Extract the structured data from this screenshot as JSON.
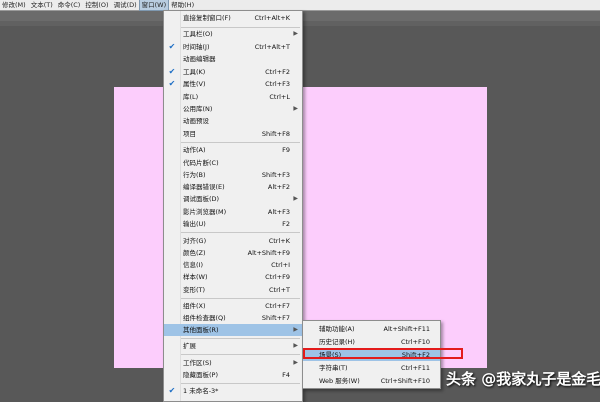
{
  "menubar": {
    "items": [
      {
        "label": "修改(M)"
      },
      {
        "label": "文本(T)"
      },
      {
        "label": "命令(C)"
      },
      {
        "label": "控制(O)"
      },
      {
        "label": "调试(D)"
      },
      {
        "label": "窗口(W)"
      },
      {
        "label": "帮助(H)"
      }
    ]
  },
  "window_menu": {
    "items": [
      {
        "label": "直接复制窗口(F)",
        "shortcut": "Ctrl+Alt+K",
        "checked": false,
        "submenu": false
      },
      {
        "label": "工具栏(O)",
        "shortcut": "",
        "checked": false,
        "submenu": true
      },
      {
        "label": "时间轴(J)",
        "shortcut": "Ctrl+Alt+T",
        "checked": true,
        "submenu": false
      },
      {
        "label": "动画编辑器",
        "shortcut": "",
        "checked": false,
        "submenu": false
      },
      {
        "label": "工具(K)",
        "shortcut": "Ctrl+F2",
        "checked": true,
        "submenu": false
      },
      {
        "label": "属性(V)",
        "shortcut": "Ctrl+F3",
        "checked": true,
        "submenu": false
      },
      {
        "label": "库(L)",
        "shortcut": "Ctrl+L",
        "checked": false,
        "submenu": false
      },
      {
        "label": "公用库(N)",
        "shortcut": "",
        "checked": false,
        "submenu": true
      },
      {
        "label": "动画预设",
        "shortcut": "",
        "checked": false,
        "submenu": false
      },
      {
        "label": "项目",
        "shortcut": "Shift+F8",
        "checked": false,
        "submenu": false
      },
      {
        "label": "动作(A)",
        "shortcut": "F9",
        "checked": false,
        "submenu": false
      },
      {
        "label": "代码片断(C)",
        "shortcut": "",
        "checked": false,
        "submenu": false
      },
      {
        "label": "行为(B)",
        "shortcut": "Shift+F3",
        "checked": false,
        "submenu": false
      },
      {
        "label": "编译器错误(E)",
        "shortcut": "Alt+F2",
        "checked": false,
        "submenu": false
      },
      {
        "label": "调试面板(D)",
        "shortcut": "",
        "checked": false,
        "submenu": true
      },
      {
        "label": "影片浏览器(M)",
        "shortcut": "Alt+F3",
        "checked": false,
        "submenu": false
      },
      {
        "label": "输出(U)",
        "shortcut": "F2",
        "checked": false,
        "submenu": false
      },
      {
        "label": "对齐(G)",
        "shortcut": "Ctrl+K",
        "checked": false,
        "submenu": false
      },
      {
        "label": "颜色(Z)",
        "shortcut": "Alt+Shift+F9",
        "checked": false,
        "submenu": false
      },
      {
        "label": "信息(I)",
        "shortcut": "Ctrl+I",
        "checked": false,
        "submenu": false
      },
      {
        "label": "样本(W)",
        "shortcut": "Ctrl+F9",
        "checked": false,
        "submenu": false
      },
      {
        "label": "变形(T)",
        "shortcut": "Ctrl+T",
        "checked": false,
        "submenu": false
      },
      {
        "label": "组件(X)",
        "shortcut": "Ctrl+F7",
        "checked": false,
        "submenu": false
      },
      {
        "label": "组件检查器(Q)",
        "shortcut": "Shift+F7",
        "checked": false,
        "submenu": false
      },
      {
        "label": "其他面板(R)",
        "shortcut": "",
        "checked": false,
        "submenu": true,
        "highlighted": true
      },
      {
        "label": "扩展",
        "shortcut": "",
        "checked": false,
        "submenu": true
      },
      {
        "label": "工作区(S)",
        "shortcut": "",
        "checked": false,
        "submenu": true
      },
      {
        "label": "隐藏面板(P)",
        "shortcut": "F4",
        "checked": false,
        "submenu": false
      },
      {
        "label": "1 未命名-3*",
        "shortcut": "",
        "checked": true,
        "submenu": false
      }
    ]
  },
  "other_panels_menu": {
    "items": [
      {
        "label": "辅助功能(A)",
        "shortcut": "Alt+Shift+F11"
      },
      {
        "label": "历史记录(H)",
        "shortcut": "Ctrl+F10"
      },
      {
        "label": "场景(S)",
        "shortcut": "Shift+F2",
        "highlighted": true
      },
      {
        "label": "字符串(T)",
        "shortcut": "Ctrl+F11"
      },
      {
        "label": "Web 服务(W)",
        "shortcut": "Ctrl+Shift+F10"
      }
    ]
  },
  "icons": {
    "check": "check-icon",
    "submenu": "chevron-right-icon"
  },
  "colors": {
    "menu_highlight": "#9ec3e6",
    "stage": "#fccdfc",
    "annotation_box": "#e31b1b",
    "check": "#1f6fc5"
  },
  "watermark": "头条 @我家丸子是金毛"
}
